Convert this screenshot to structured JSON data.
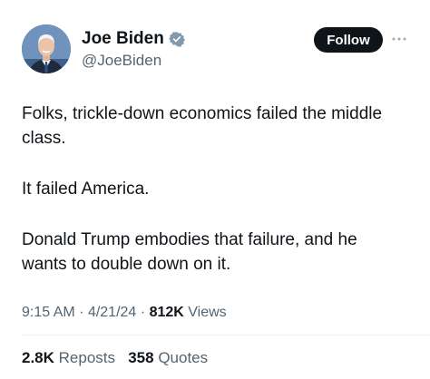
{
  "author": {
    "display_name": "Joe Biden",
    "handle": "@JoeBiden",
    "verified_icon": "verified-badge-icon",
    "verified_color": "#829aab"
  },
  "actions": {
    "follow_label": "Follow",
    "more_icon": "more-horizontal-icon"
  },
  "tweet": {
    "paragraphs": [
      "Folks, trickle-down economics failed the middle class.",
      "It failed America.",
      "Donald Trump embodies that failure, and he wants to double down on it."
    ]
  },
  "meta": {
    "time": "9:15 AM",
    "separator": "·",
    "date": "4/21/24",
    "views_count": "812K",
    "views_label": "Views"
  },
  "stats": {
    "reposts_count": "2.8K",
    "reposts_label": "Reposts",
    "quotes_count": "358",
    "quotes_label": "Quotes"
  }
}
